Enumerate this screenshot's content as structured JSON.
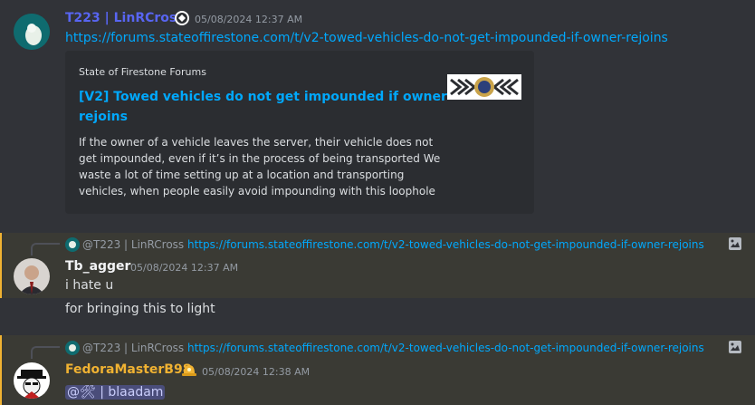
{
  "messages": [
    {
      "author": "T223 | LinRCross",
      "timestamp": "05/08/2024 12:37 AM",
      "link": "https://forums.stateoffirestone.com/t/v2-towed-vehicles-do-not-get-impounded-if-owner-rejoins",
      "embed": {
        "site": "State of Firestone Forums",
        "title_line1": "[V2] Towed vehicles do not get impounded if owner",
        "title_line2": "rejoins",
        "desc_lines": [
          "If the owner of a vehicle leaves the server, their vehicle does not",
          "get impounded, even if it’s in the process of being transported We",
          "waste a lot of time setting up at a location and transporting",
          "vehicles, when people easily avoid impounding with this loophole"
        ]
      }
    },
    {
      "reply_author": "@T223 | LinRCross",
      "reply_link": "https://forums.stateoffirestone.com/t/v2-towed-vehicles-do-not-get-impounded-if-owner-rejoins",
      "author": "Tb_agger",
      "timestamp": "05/08/2024 12:37 AM",
      "lines": [
        "i hate u",
        "for bringing this to light"
      ]
    },
    {
      "reply_author": "@T223 | LinRCross",
      "reply_link": "https://forums.stateoffirestone.com/t/v2-towed-vehicles-do-not-get-impounded-if-owner-rejoins",
      "author": "FedoraMasterB98",
      "timestamp": "05/08/2024 12:38 AM",
      "mention": "@🛠 | blaadam"
    }
  ],
  "colors": {
    "author1": "#5865f2",
    "author2": "#f2f3f5",
    "author3": "#f0b232",
    "link": "#00a8fc"
  }
}
